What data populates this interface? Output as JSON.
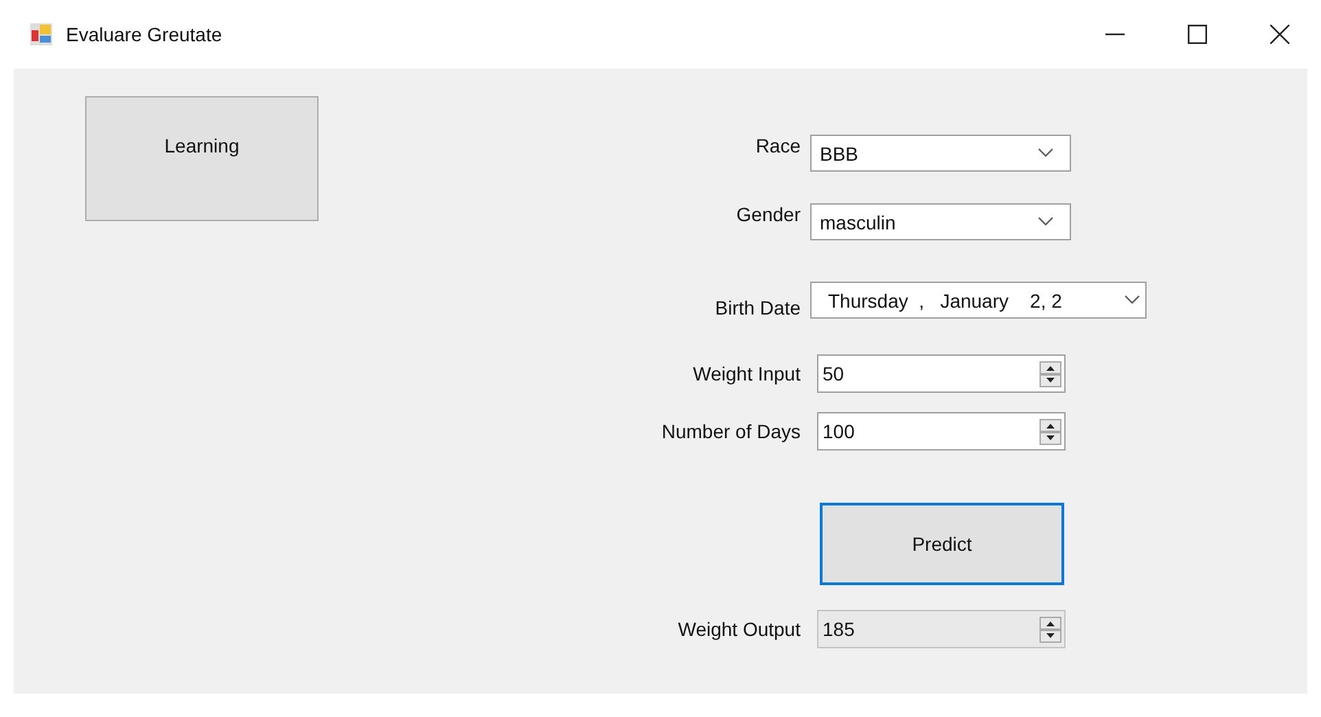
{
  "window": {
    "title": "Evaluare Greutate"
  },
  "buttons": [
    {
      "label": "Learning",
      "focused": false
    }
  ],
  "fields": [
    {
      "label": "Race",
      "kind": "combo",
      "value": "BBB"
    },
    {
      "label": "Gender",
      "kind": "combo",
      "value": "masculin"
    },
    {
      "label": "Birth Date",
      "kind": "date",
      "value": "Thursday  ,   January    2, 2"
    },
    {
      "label": "Weight Input",
      "kind": "spin",
      "value": "50",
      "read_only": false
    },
    {
      "label": "Number of Days",
      "kind": "spin",
      "value": "100",
      "read_only": false
    },
    {
      "label": "Predict",
      "kind": "button",
      "focused": true
    },
    {
      "label": "Weight Output",
      "kind": "spin",
      "value": "185",
      "read_only": true
    }
  ]
}
